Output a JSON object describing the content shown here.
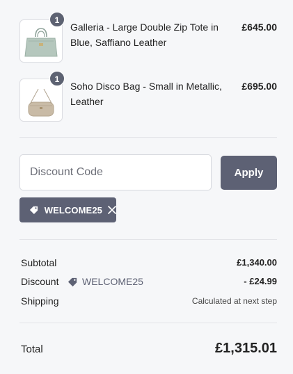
{
  "cart": {
    "items": [
      {
        "quantity": "1",
        "name": "Galleria - Large Double Zip Tote in Blue, Saffiano Leather",
        "price": "£645.00",
        "image_icon": "tote-bag-image"
      },
      {
        "quantity": "1",
        "name": "Soho Disco Bag - Small in Metallic, Leather",
        "price": "£695.00",
        "image_icon": "crossbody-bag-image"
      }
    ]
  },
  "discount": {
    "placeholder": "Discount Code",
    "apply_label": "Apply",
    "applied_code": "WELCOME25",
    "tag_icon": "tag-icon",
    "remove_icon": "close-icon"
  },
  "summary": {
    "subtotal_label": "Subtotal",
    "subtotal_value": "£1,340.00",
    "discount_label": "Discount",
    "discount_code": "WELCOME25",
    "discount_value": "- £24.99",
    "shipping_label": "Shipping",
    "shipping_value": "Calculated at next step",
    "total_label": "Total",
    "total_value": "£1,315.01"
  },
  "colors": {
    "accent": "#5d6174",
    "background": "#f6f7f9",
    "divider": "#e3e4e8"
  }
}
